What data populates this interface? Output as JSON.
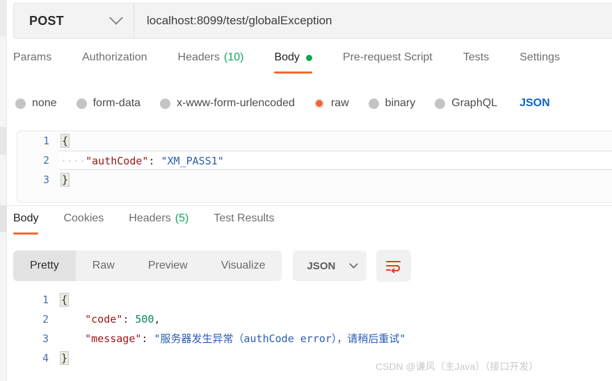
{
  "request": {
    "method": "POST",
    "url": "localhost:8099/test/globalException",
    "tabs": [
      {
        "label": "Params",
        "count": "",
        "active": false,
        "dot": false
      },
      {
        "label": "Authorization",
        "count": "",
        "active": false,
        "dot": false
      },
      {
        "label": "Headers",
        "count": "(10)",
        "active": false,
        "dot": false
      },
      {
        "label": "Body",
        "count": "",
        "active": true,
        "dot": true
      },
      {
        "label": "Pre-request Script",
        "count": "",
        "active": false,
        "dot": false
      },
      {
        "label": "Tests",
        "count": "",
        "active": false,
        "dot": false
      },
      {
        "label": "Settings",
        "count": "",
        "active": false,
        "dot": false
      }
    ],
    "body_types": [
      {
        "label": "none",
        "selected": false
      },
      {
        "label": "form-data",
        "selected": false
      },
      {
        "label": "x-www-form-urlencoded",
        "selected": false
      },
      {
        "label": "raw",
        "selected": true
      },
      {
        "label": "binary",
        "selected": false
      },
      {
        "label": "GraphQL",
        "selected": false
      }
    ],
    "raw_format": "JSON",
    "editor": {
      "lines": [
        {
          "number": "1",
          "brace": "{",
          "content": "",
          "active": false
        },
        {
          "number": "2",
          "indent": "····",
          "key": "\"authCode\"",
          "colon": ": ",
          "value": "\"XM_PASS1\"",
          "active": true
        },
        {
          "number": "3",
          "brace": "}",
          "content": "",
          "active": false
        }
      ]
    }
  },
  "response": {
    "tabs": [
      {
        "label": "Body",
        "count": "",
        "active": true
      },
      {
        "label": "Cookies",
        "count": "",
        "active": false
      },
      {
        "label": "Headers",
        "count": "(5)",
        "active": false
      },
      {
        "label": "Test Results",
        "count": "",
        "active": false
      }
    ],
    "view_modes": [
      {
        "label": "Pretty",
        "active": true
      },
      {
        "label": "Raw",
        "active": false
      },
      {
        "label": "Preview",
        "active": false
      },
      {
        "label": "Visualize",
        "active": false
      }
    ],
    "format": "JSON",
    "body": {
      "line1_number": "1",
      "line1_brace": "{",
      "line2_number": "2",
      "line2_key": "\"code\"",
      "line2_colon": ": ",
      "line2_value": "500",
      "line2_comma": ",",
      "line3_number": "3",
      "line3_key": "\"message\"",
      "line3_colon": ": ",
      "line3_value": "\"服务器发生异常（authCode error），请稍后重试\"",
      "line4_number": "4",
      "line4_brace": "}"
    }
  },
  "watermark": "CSDN @谦风（主Java）（接口开发）",
  "colors": {
    "accent_orange": "#ef6c2f",
    "success_green": "#11a75c",
    "link_blue": "#0b63ce",
    "json_key": "#a31515",
    "json_string": "#2a5db0",
    "json_number": "#098658"
  }
}
